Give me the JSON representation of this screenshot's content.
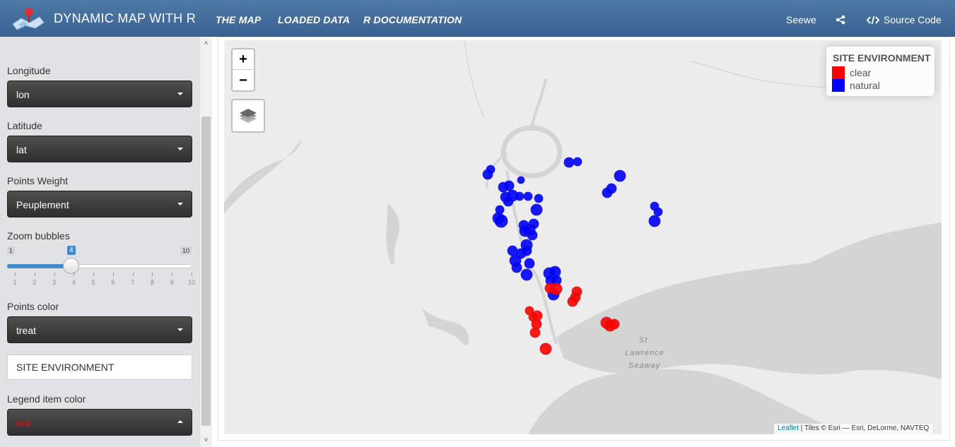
{
  "navbar": {
    "title": "DYNAMIC MAP WITH R",
    "tabs": [
      {
        "label": "THE MAP"
      },
      {
        "label": "LOADED DATA"
      },
      {
        "label": "R DOCUMENTATION"
      }
    ],
    "right": {
      "user": "Seewe",
      "source_code": "Source Code"
    },
    "icons": {
      "brand": "map-pin-icon",
      "share": "share-icon",
      "code": "code-icon"
    }
  },
  "sidebar": {
    "longitude": {
      "label": "Longitude",
      "value": "lon"
    },
    "latitude": {
      "label": "Latitude",
      "value": "lat"
    },
    "weight": {
      "label": "Points Weight",
      "value": "Peuplement"
    },
    "zoom": {
      "label": "Zoom bubbles",
      "min": "1",
      "max": "10",
      "value": "4",
      "ticks": [
        "1",
        "2",
        "3",
        "4",
        "5",
        "6",
        "7",
        "8",
        "9",
        "10"
      ]
    },
    "color": {
      "label": "Points color",
      "value": "treat"
    },
    "legend_title_input": "SITE ENVIRONMENT",
    "legend_color": {
      "label": "Legend item color",
      "value": "red"
    }
  },
  "map": {
    "zoom_in": "+",
    "zoom_out": "−",
    "legend": {
      "title": "SITE ENVIRONMENT",
      "items": [
        {
          "label": "clear",
          "color": "#ff0000"
        },
        {
          "label": "natural",
          "color": "#0000ff"
        }
      ]
    },
    "place_labels": [
      "St",
      "Lawrence",
      "Seaway"
    ],
    "attribution": {
      "link": "Leaflet",
      "text": " | Tiles © Esri — Esri, DeLorme, NAVTEQ"
    },
    "colors": {
      "natural": "#0000ff",
      "clear": "#ff0000",
      "water": "#d4d4d4",
      "land": "#ececec"
    }
  }
}
